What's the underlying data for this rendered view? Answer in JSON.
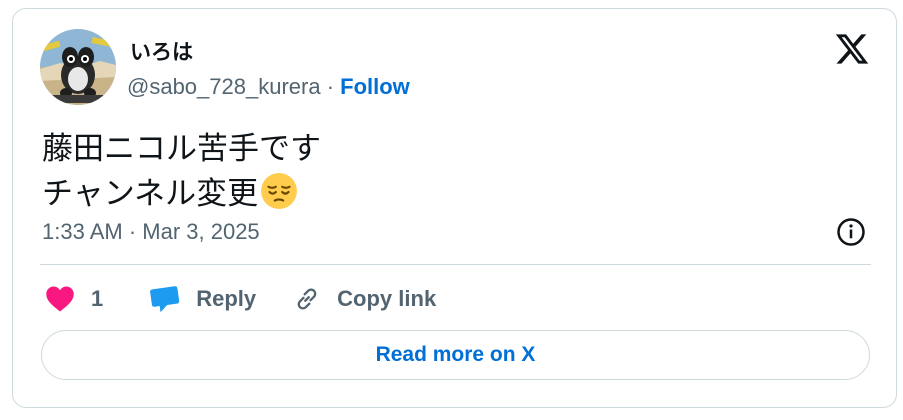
{
  "user": {
    "display_name": "いろは",
    "handle": "@sabo_728_kurera",
    "separator": " · ",
    "follow_label": "Follow"
  },
  "tweet": {
    "text_lines": [
      "藤田ニコル苦手です",
      "チャンネル変更"
    ],
    "emoji": "pensive-face-emoji",
    "timestamp": "1:33 AM · Mar 3, 2025"
  },
  "actions": {
    "like_count": "1",
    "reply_label": "Reply",
    "copy_link_label": "Copy link"
  },
  "read_more_label": "Read more on X",
  "icons": {
    "brand": "x-logo-icon",
    "info": "info-icon",
    "like": "heart-icon",
    "reply": "speech-bubble-icon",
    "copy": "link-icon"
  },
  "colors": {
    "like": "#f91880",
    "reply": "#1d9bf0",
    "link": "#006fd6",
    "muted": "#536471",
    "text": "#0f1419",
    "border": "#cfd9de"
  }
}
